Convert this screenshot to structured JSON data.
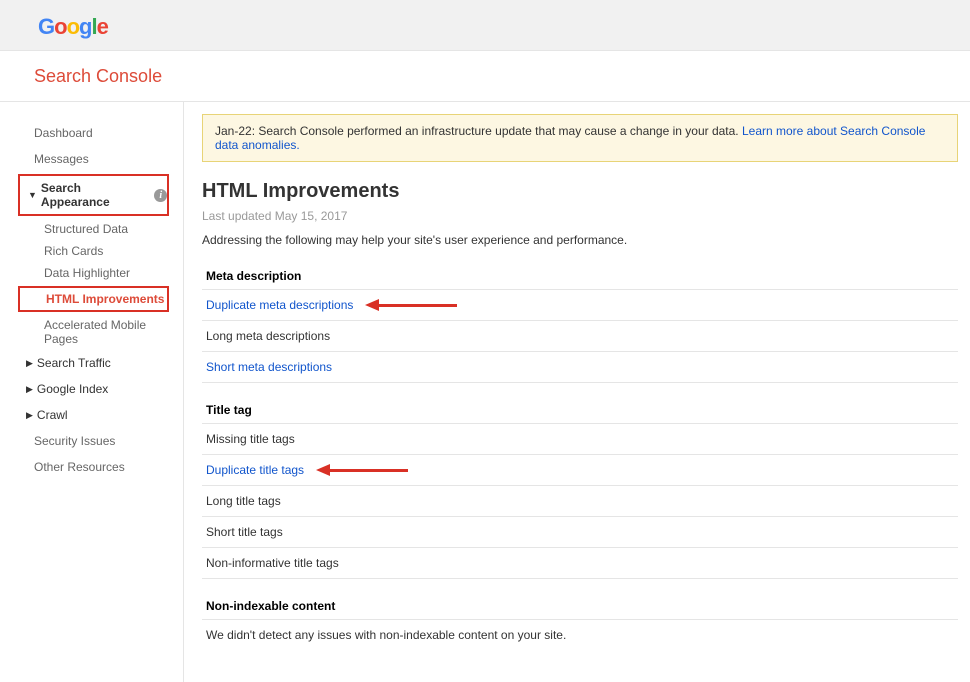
{
  "logo": {
    "g1": "G",
    "o1": "o",
    "o2": "o",
    "g2": "g",
    "l": "l",
    "e": "e"
  },
  "console_title": "Search Console",
  "nav": {
    "dashboard": "Dashboard",
    "messages": "Messages",
    "search_appearance": "Search Appearance",
    "structured_data": "Structured Data",
    "rich_cards": "Rich Cards",
    "data_highlighter": "Data Highlighter",
    "html_improvements": "HTML Improvements",
    "amp": "Accelerated Mobile Pages",
    "search_traffic": "Search Traffic",
    "google_index": "Google Index",
    "crawl": "Crawl",
    "security_issues": "Security Issues",
    "other_resources": "Other Resources"
  },
  "notice_prefix": "Jan-22: Search Console performed an infrastructure update that may cause a change in your data. ",
  "notice_link": "Learn more about Search Console data anomalies.",
  "page_title": "HTML Improvements",
  "updated": "Last updated May 15, 2017",
  "desc": "Addressing the following may help your site's user experience and performance.",
  "groups": {
    "meta": {
      "header": "Meta description",
      "rows": [
        {
          "label": "Duplicate meta descriptions",
          "link": true,
          "arrow": true
        },
        {
          "label": "Long meta descriptions",
          "link": false,
          "arrow": false
        },
        {
          "label": "Short meta descriptions",
          "link": true,
          "arrow": false
        }
      ]
    },
    "title": {
      "header": "Title tag",
      "rows": [
        {
          "label": "Missing title tags",
          "link": false,
          "arrow": false
        },
        {
          "label": "Duplicate title tags",
          "link": true,
          "arrow": true
        },
        {
          "label": "Long title tags",
          "link": false,
          "arrow": false
        },
        {
          "label": "Short title tags",
          "link": false,
          "arrow": false
        },
        {
          "label": "Non-informative title tags",
          "link": false,
          "arrow": false
        }
      ]
    },
    "nonindex": {
      "header": "Non-indexable content",
      "text": "We didn't detect any issues with non-indexable content on your site."
    }
  }
}
